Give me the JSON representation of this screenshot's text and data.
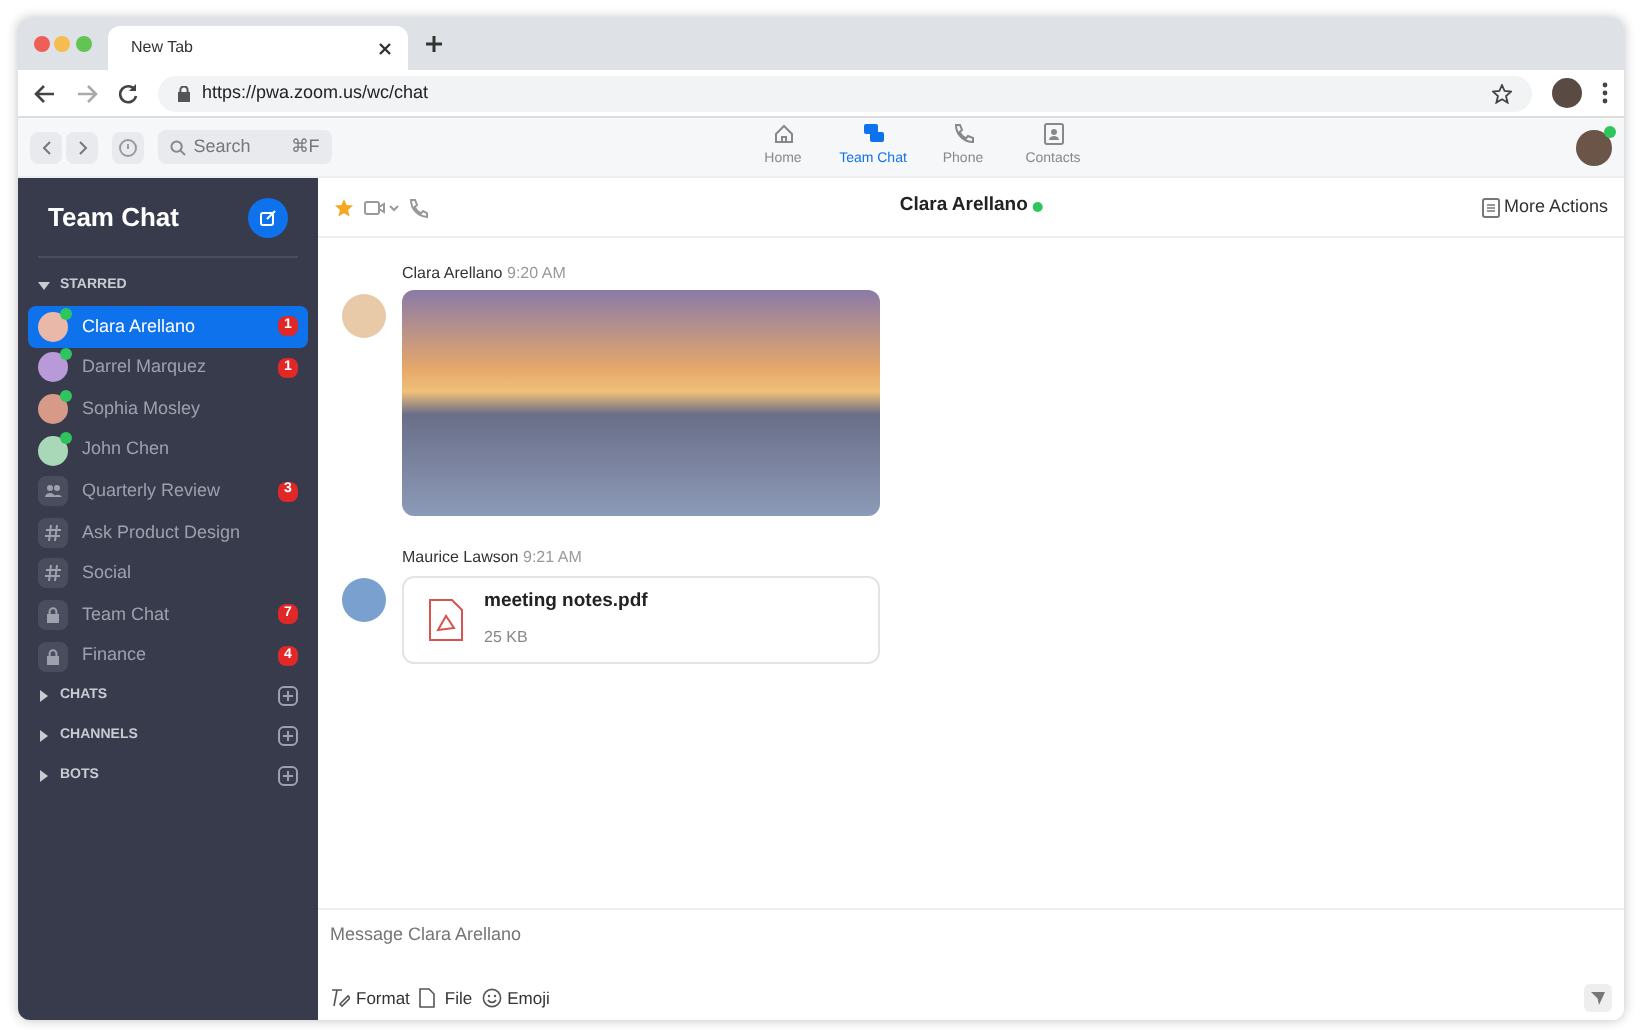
{
  "browser": {
    "tab_title": "New Tab",
    "url": "https://pwa.zoom.us/wc/chat"
  },
  "toolbar": {
    "search_placeholder": "Search",
    "shortcut": "⌘F",
    "nav": [
      {
        "label": "Home",
        "kind": "home",
        "selected": false
      },
      {
        "label": "Team Chat",
        "kind": "chat",
        "selected": true
      },
      {
        "label": "Phone",
        "kind": "phone",
        "selected": false
      },
      {
        "label": "Contacts",
        "kind": "contacts",
        "selected": false
      }
    ],
    "user_online": true
  },
  "sidebar": {
    "title": "Team Chat",
    "sections": [
      {
        "label": "STARRED",
        "expanded": true,
        "items": [
          {
            "name": "Clara Arellano",
            "kind": "person",
            "online": true,
            "selected": true,
            "badge": "1"
          },
          {
            "name": "Darrel Marquez",
            "kind": "person",
            "online": true,
            "selected": false,
            "badge": "1"
          },
          {
            "name": "Sophia Mosley",
            "kind": "person",
            "online": true,
            "selected": false
          },
          {
            "name": "John Chen",
            "kind": "person",
            "online": true,
            "selected": false
          },
          {
            "name": "Quarterly Review",
            "kind": "group",
            "selected": false,
            "badge": "3"
          },
          {
            "name": "Ask Product Design",
            "kind": "channel",
            "selected": false
          },
          {
            "name": "Social",
            "kind": "channel",
            "selected": false
          },
          {
            "name": "Team Chat",
            "kind": "private",
            "selected": false,
            "badge": "7"
          },
          {
            "name": "Finance",
            "kind": "private",
            "selected": false,
            "badge": "4"
          }
        ]
      },
      {
        "label": "CHATS",
        "expanded": false
      },
      {
        "label": "CHANNELS",
        "expanded": false
      },
      {
        "label": "BOTS",
        "expanded": false
      }
    ]
  },
  "chat": {
    "title": "Clara Arellano",
    "online": true,
    "starred": true,
    "more_actions": "More Actions",
    "messages": [
      {
        "sender": "Clara Arellano",
        "time": "9:20 AM",
        "kind": "image"
      },
      {
        "sender": "Maurice Lawson",
        "time": "9:21 AM",
        "kind": "file",
        "file_name": "meeting notes.pdf",
        "file_size": "25 KB"
      }
    ],
    "composer": {
      "placeholder": "Message Clara Arellano",
      "tools": [
        {
          "label": "Format",
          "kind": "format"
        },
        {
          "label": "File",
          "kind": "file"
        },
        {
          "label": "Emoji",
          "kind": "emoji"
        }
      ]
    }
  }
}
